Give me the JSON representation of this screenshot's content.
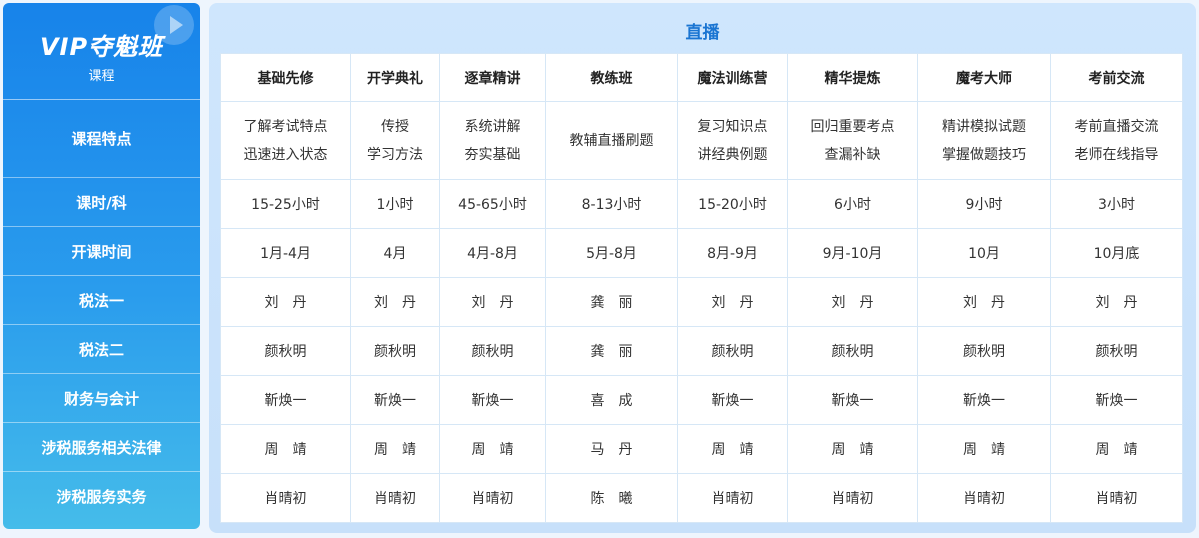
{
  "brand": {
    "title": "VIP夺魁班",
    "subtitle": "课程",
    "icon": "play-icon"
  },
  "section_title": "直播",
  "row_labels": [
    "课程特点",
    "课时/科",
    "开课时间",
    "税法一",
    "税法二",
    "财务与会计",
    "涉税服务相关法律",
    "涉税服务实务"
  ],
  "columns": [
    "基础先修",
    "开学典礼",
    "逐章精讲",
    "教练班",
    "魔法训练营",
    "精华提炼",
    "魔考大师",
    "考前交流"
  ],
  "features": [
    [
      "了解考试特点",
      "迅速进入状态"
    ],
    [
      "传授",
      "学习方法"
    ],
    [
      "系统讲解",
      "夯实基础"
    ],
    [
      "教辅直播刷题"
    ],
    [
      "复习知识点",
      "讲经典例题"
    ],
    [
      "回归重要考点",
      "查漏补缺"
    ],
    [
      "精讲模拟试题",
      "掌握做题技巧"
    ],
    [
      "考前直播交流",
      "老师在线指导"
    ]
  ],
  "rows": [
    [
      "15-25小时",
      "1小时",
      "45-65小时",
      "8-13小时",
      "15-20小时",
      "6小时",
      "9小时",
      "3小时"
    ],
    [
      "1月-4月",
      "4月",
      "4月-8月",
      "5月-8月",
      "8月-9月",
      "9月-10月",
      "10月",
      "10月底"
    ],
    [
      "刘　丹",
      "刘　丹",
      "刘　丹",
      "龚　丽",
      "刘　丹",
      "刘　丹",
      "刘　丹",
      "刘　丹"
    ],
    [
      "颜秋明",
      "颜秋明",
      "颜秋明",
      "龚　丽",
      "颜秋明",
      "颜秋明",
      "颜秋明",
      "颜秋明"
    ],
    [
      "靳焕一",
      "靳焕一",
      "靳焕一",
      "喜　成",
      "靳焕一",
      "靳焕一",
      "靳焕一",
      "靳焕一"
    ],
    [
      "周　靖",
      "周　靖",
      "周　靖",
      "马　丹",
      "周　靖",
      "周　靖",
      "周　靖",
      "周　靖"
    ],
    [
      "肖晴初",
      "肖晴初",
      "肖晴初",
      "陈　曦",
      "肖晴初",
      "肖晴初",
      "肖晴初",
      "肖晴初"
    ]
  ]
}
